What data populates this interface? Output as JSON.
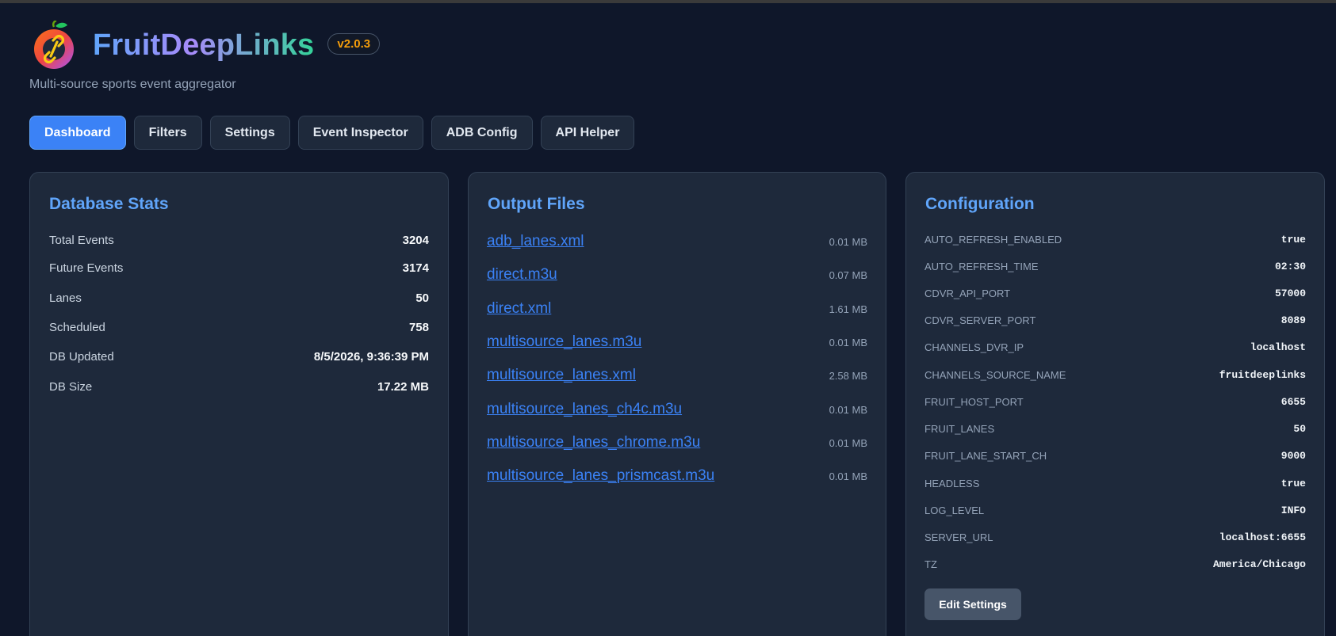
{
  "app": {
    "title": "FruitDeepLinks",
    "version": "v2.0.3",
    "subtitle": "Multi-source sports event aggregator",
    "accent": "#3b82f6"
  },
  "tabs": [
    {
      "label": "Dashboard",
      "active": true
    },
    {
      "label": "Filters",
      "active": false
    },
    {
      "label": "Settings",
      "active": false
    },
    {
      "label": "Event Inspector",
      "active": false
    },
    {
      "label": "ADB Config",
      "active": false
    },
    {
      "label": "API Helper",
      "active": false
    }
  ],
  "db_stats": {
    "title": "Database Stats",
    "rows": [
      {
        "label": "Total Events",
        "value": "3204"
      },
      {
        "label": "Future Events",
        "value": "3174"
      },
      {
        "label": "Lanes",
        "value": "50"
      },
      {
        "label": "Scheduled",
        "value": "758"
      },
      {
        "label": "DB Updated",
        "value": "8/5/2026, 9:36:39 PM"
      },
      {
        "label": "DB Size",
        "value": "17.22 MB"
      }
    ]
  },
  "output_files": {
    "title": "Output Files",
    "files": [
      {
        "name": "adb_lanes.xml",
        "size": "0.01 MB"
      },
      {
        "name": "direct.m3u",
        "size": "0.07 MB"
      },
      {
        "name": "direct.xml",
        "size": "1.61 MB"
      },
      {
        "name": "multisource_lanes.m3u",
        "size": "0.01 MB"
      },
      {
        "name": "multisource_lanes.xml",
        "size": "2.58 MB"
      },
      {
        "name": "multisource_lanes_ch4c.m3u",
        "size": "0.01 MB"
      },
      {
        "name": "multisource_lanes_chrome.m3u",
        "size": "0.01 MB"
      },
      {
        "name": "multisource_lanes_prismcast.m3u",
        "size": "0.01 MB"
      }
    ]
  },
  "configuration": {
    "title": "Configuration",
    "items": [
      {
        "key": "AUTO_REFRESH_ENABLED",
        "value": "true"
      },
      {
        "key": "AUTO_REFRESH_TIME",
        "value": "02:30"
      },
      {
        "key": "CDVR_API_PORT",
        "value": "57000"
      },
      {
        "key": "CDVR_SERVER_PORT",
        "value": "8089"
      },
      {
        "key": "CHANNELS_DVR_IP",
        "value": "localhost"
      },
      {
        "key": "CHANNELS_SOURCE_NAME",
        "value": "fruitdeeplinks"
      },
      {
        "key": "FRUIT_HOST_PORT",
        "value": "6655"
      },
      {
        "key": "FRUIT_LANES",
        "value": "50"
      },
      {
        "key": "FRUIT_LANE_START_CH",
        "value": "9000"
      },
      {
        "key": "HEADLESS",
        "value": "true"
      },
      {
        "key": "LOG_LEVEL",
        "value": "INFO"
      },
      {
        "key": "SERVER_URL",
        "value": "localhost:6655"
      },
      {
        "key": "TZ",
        "value": "America/Chicago"
      }
    ],
    "edit_label": "Edit Settings"
  }
}
